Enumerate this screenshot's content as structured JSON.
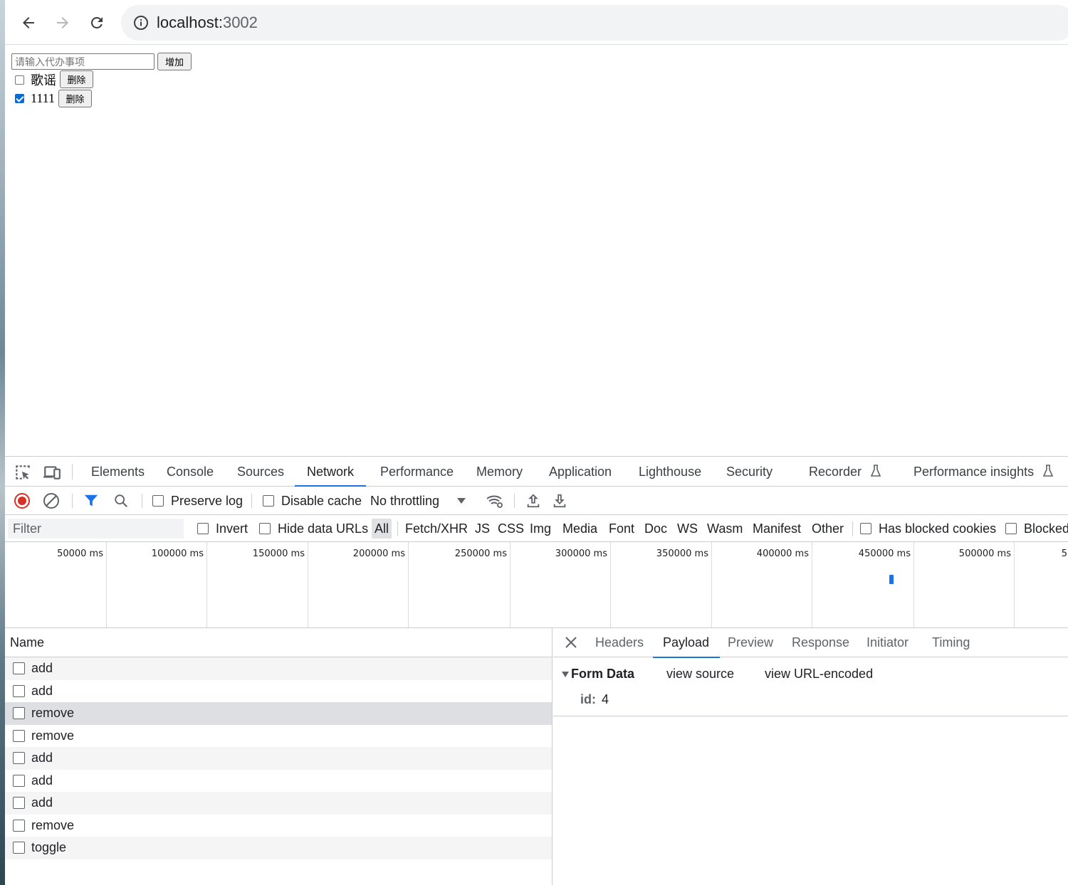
{
  "browser": {
    "url_host": "localhost:",
    "url_port": "3002"
  },
  "page": {
    "todo_placeholder": "请输入代办事项",
    "add_label": "增加",
    "todos": [
      {
        "text": "歌谣",
        "done": false,
        "delete_label": "删除"
      },
      {
        "text": "1111",
        "done": true,
        "delete_label": "删除"
      }
    ]
  },
  "devtools": {
    "tabs": [
      "Elements",
      "Console",
      "Sources",
      "Network",
      "Performance",
      "Memory",
      "Application",
      "Lighthouse",
      "Security",
      "Recorder",
      "Performance insights"
    ],
    "active_tab": "Network",
    "toolbar": {
      "preserve_log": "Preserve log",
      "disable_cache": "Disable cache",
      "throttling": "No throttling"
    },
    "filterbar": {
      "filter_placeholder": "Filter",
      "invert": "Invert",
      "hide_data_urls": "Hide data URLs",
      "types": [
        "All",
        "Fetch/XHR",
        "JS",
        "CSS",
        "Img",
        "Media",
        "Font",
        "Doc",
        "WS",
        "Wasm",
        "Manifest",
        "Other"
      ],
      "has_blocked_cookies": "Has blocked cookies",
      "blocked": "Blocked"
    },
    "timeline_labels": [
      "50000 ms",
      "100000 ms",
      "150000 ms",
      "200000 ms",
      "250000 ms",
      "300000 ms",
      "350000 ms",
      "400000 ms",
      "450000 ms",
      "500000 ms",
      "5"
    ],
    "requests": {
      "column_name": "Name",
      "rows": [
        "add",
        "add",
        "remove",
        "remove",
        "add",
        "add",
        "add",
        "remove",
        "toggle"
      ],
      "selected_index": 2
    },
    "detail": {
      "tabs": [
        "Headers",
        "Payload",
        "Preview",
        "Response",
        "Initiator",
        "Timing"
      ],
      "active_tab": "Payload",
      "form_data_label": "Form Data",
      "view_source": "view source",
      "view_url_encoded": "view URL-encoded",
      "field_key": "id:",
      "field_value": "4"
    },
    "colors": {
      "accent": "#1a73e8",
      "record": "#d93025"
    }
  }
}
